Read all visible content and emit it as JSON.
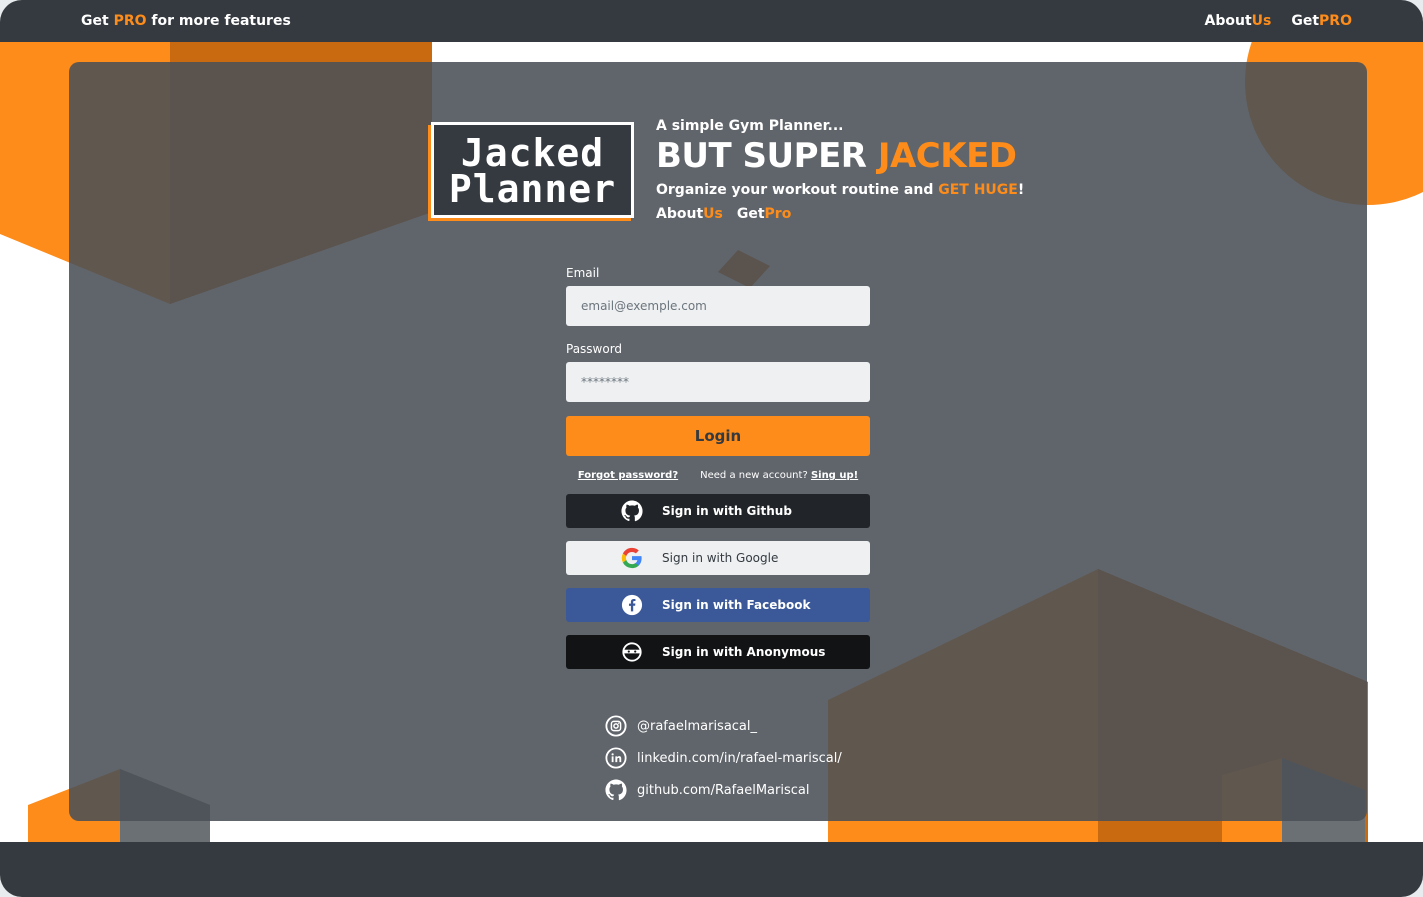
{
  "topbar": {
    "promo_prefix": "Get ",
    "promo_accent": "PRO",
    "promo_suffix": " for more features",
    "about_prefix": "About",
    "about_accent": "Us",
    "getpro_prefix": "Get",
    "getpro_accent": "PRO"
  },
  "logo": {
    "line1": "Jacked",
    "line2": "Planner"
  },
  "hero": {
    "subtitle": "A simple Gym Planner...",
    "headline_prefix": "BUT SUPER ",
    "headline_accent": "JACKED",
    "tagline_prefix": "Organize your workout routine and ",
    "tagline_accent": "GET HUGE",
    "tagline_suffix": "!",
    "about_prefix": "About",
    "about_accent": "Us",
    "getpro_prefix": "Get",
    "getpro_accent": "Pro"
  },
  "form": {
    "email_label": "Email",
    "email_placeholder": "email@exemple.com",
    "password_label": "Password",
    "password_placeholder": "********",
    "login_label": "Login",
    "forgot_label": "Forgot password?",
    "need_account": "Need a new account? ",
    "signup_label": "Sing up!"
  },
  "sso": {
    "github": "Sign in with Github",
    "google": "Sign in with Google",
    "facebook": "Sign in with Facebook",
    "anonymous": "Sign in with Anonymous"
  },
  "socials": {
    "instagram": "@rafaelmarisacal_",
    "linkedin": "linkedin.com/in/rafael-mariscal/",
    "github": "github.com/RafaelMariscal"
  },
  "colors": {
    "accent": "#fd8c1a",
    "dark": "#343a40",
    "facebook": "#3b5998"
  }
}
